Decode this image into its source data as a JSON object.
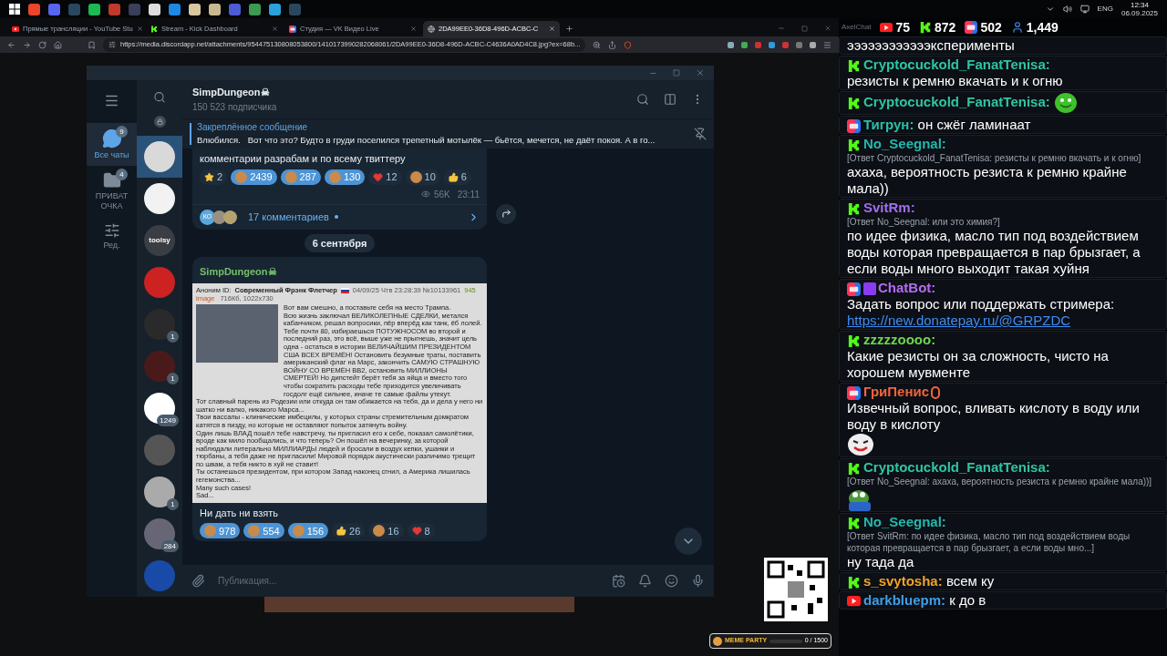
{
  "taskbar": {
    "language": "ENG",
    "time": "12:34",
    "date": "06.09.2025"
  },
  "browser": {
    "tabs": [
      {
        "title": "Прямые трансляции - YouTube Stu",
        "kind": "youtube",
        "selected": false
      },
      {
        "title": "Stream - Kick Dashboard",
        "kind": "kick",
        "selected": false
      },
      {
        "title": "Студия — VK Видео Live",
        "kind": "vk",
        "selected": false
      },
      {
        "title": "2DA99EE0-36D8-496D-ACBC-C",
        "kind": "page",
        "selected": true
      }
    ],
    "url": "https://media.discordapp.net/attachments/954475130808053800/1410173990282068061/2DA99EE0-36D8-496D-ACBC-C4636A0AD4C8.jpg?ex=68b..."
  },
  "telegram": {
    "folders": [
      {
        "kind": "chats",
        "label": "Все чаты",
        "badge": "9",
        "selected": true
      },
      {
        "kind": "folder",
        "label": "ПРИВАТОЧКА",
        "badge": "4",
        "selected": false
      },
      {
        "kind": "edit",
        "label": "Ред.",
        "selected": false
      }
    ],
    "chats": [
      {
        "selected": true
      },
      {
        "selected": false
      },
      {
        "selected": false,
        "label": "toolsy"
      },
      {
        "selected": false
      },
      {
        "selected": false,
        "badge": "1"
      },
      {
        "selected": false,
        "badge": "1"
      },
      {
        "selected": false,
        "badge": "1249"
      },
      {
        "selected": false
      },
      {
        "selected": false,
        "badge": "1"
      },
      {
        "selected": false,
        "badge": "284"
      },
      {
        "selected": false
      }
    ],
    "channel": {
      "title": "SimpDungeon☠",
      "subtitle": "150 523 подписчика"
    },
    "pinned": {
      "label": "Закреплённое сообщение",
      "text": "Влюбился.   Вот что это? Будто в груди поселился трепетный мотылёк — бьётся, мечется, не даёт покоя. А в го..."
    },
    "messages": [
      {
        "kind": "post",
        "text": "комментарии разрабам и по всему твиттеру",
        "views": "56K",
        "time": "23:11",
        "comments": "17 комментариев",
        "commenter": "КО",
        "reactions": [
          {
            "kind": "star",
            "count": "2",
            "selected": false
          },
          {
            "kind": "sticker",
            "count": "2439",
            "selected": true
          },
          {
            "kind": "sticker",
            "count": "287",
            "selected": true
          },
          {
            "kind": "sticker",
            "count": "130",
            "selected": true
          },
          {
            "kind": "heart",
            "count": "12",
            "selected": false
          },
          {
            "kind": "sticker",
            "count": "10",
            "selected": false
          },
          {
            "kind": "thumb",
            "count": "6",
            "selected": false
          }
        ]
      },
      {
        "kind": "date",
        "text": "6 сентября"
      },
      {
        "kind": "post",
        "author": "SimpDungeon☠",
        "caption": "Ни дать ни взять",
        "image": {
          "anon": "Аноним ID:",
          "name": "Современный Фрэнк Флетчер",
          "stamp": "04/09/25 Чтв 23:28:39 №10133961",
          "count": "945",
          "file": "image",
          "file_info": "716Кб, 1022x730",
          "lines": [
            "Вот вам смешно, а поставьте себя на место Трампа.",
            "Всю жизнь заключал ВЕЛИКОЛЕПНЫЕ СДЕЛКИ, метался кабанчиком, решал вопросики, пёр вперёд как танк, ёб лолей. Тебе почти 80, избираешься ПОТУЖНОСОМ во второй и последний раз, это всё, выше уже не прыгнешь, значит цель одна - остаться в истории ВЕЛИЧАЙШИМ ПРЕЗИДЕНТОМ США ВСЕХ ВРЕМЁН! Остановить безумные траты, поставить американский флаг на Марс, закончить САМУЮ СТРАШНУЮ ВОЙНУ СО ВРЕМЁН ВВ2, остановить МИЛЛИОНЫ СМЕРТЕЙ! Но дипстейт берёт тебя за яйца и вместо того чтобы сократить расходы тебе приходится увеличивать госдолг ещё сильнее, иначе те самые файлы утекут.",
            "Тот славный парень из Родезии или откуда он там обижается на тебя, да и дела у него ни шатко ни валко, никакого Марса...",
            "Твои вассалы - клинические имбецилы, у которых страны стремительным домкратом катятся в пизду, но которые не оставляют попыток затянуть войну.",
            "Один лишь ВЛАД пошёл тебе навстречу, ты пригласил его к себе, показал самолётики, вроде как мило пообщались, и что теперь? Он пошёл на вечеринку, за которой наблюдали литерально МИЛЛИАРДЫ людей и бросали в воздух кепки, ушанки и тюрбаны, а тебя даже не пригласили! Мировой порядок акустически различимо трещит по швам, а тебя никто в хуй не ставит!",
            "Ты останешься президентом, при котором Запад наконец сгнил, а Америка лишилась гегемонства...",
            "Many such cases!",
            "Sad..."
          ]
        },
        "reactions": [
          {
            "kind": "sticker",
            "count": "978",
            "selected": true
          },
          {
            "kind": "sticker",
            "count": "554",
            "selected": true
          },
          {
            "kind": "sticker",
            "count": "156",
            "selected": true
          },
          {
            "kind": "thumb",
            "count": "26",
            "selected": false
          },
          {
            "kind": "sticker",
            "count": "16",
            "selected": false
          },
          {
            "kind": "heart",
            "count": "8",
            "selected": false
          }
        ]
      }
    ],
    "input": {
      "placeholder": "Публикация..."
    }
  },
  "chat": {
    "title": "AxelChat",
    "counts": [
      {
        "kind": "youtube",
        "value": "75"
      },
      {
        "kind": "kick",
        "value": "872"
      },
      {
        "kind": "vk",
        "value": "502"
      },
      {
        "kind": "viewers",
        "value": "1,449"
      }
    ],
    "messages": [
      {
        "text": "ээээээээээээксперименты"
      },
      {
        "kind": "kick",
        "author": "Cryptocuckold_FanatTenisa:",
        "color": "#2fc5a2",
        "text": "резисты к ремню вкачать и к огню"
      },
      {
        "kind": "kick",
        "author": "Cryptocuckold_FanatTenisa:",
        "color": "#2fc5a2",
        "emote": {
          "kind": "smile"
        }
      },
      {
        "kind": "vk",
        "author": "Тигрун:",
        "color": "#2bbfa8",
        "text": "он сжёг ламинаат"
      },
      {
        "kind": "kick",
        "author": "No_Seegnal:",
        "color": "#22b8ad",
        "reply": "[Ответ Cryptocuckold_FanatTenisa: резисты к ремню вкачать и к огню]",
        "text": "ахаха, вероятность резиста к ремню крайне мала))"
      },
      {
        "kind": "kick",
        "author": "SvitRm:",
        "color": "#a46cf2",
        "reply": "[Ответ No_Seegnal: или это химия?]",
        "text": "по идее физика, масло тип под воздействием воды которая превращается в пар брызгает, а если воды много выходит такая хуйня"
      },
      {
        "kind": "vk",
        "badge": {
          "kind": "bot"
        },
        "author": "ChatBot:",
        "color": "#b46cf5",
        "text": "Задать вопрос или поддержать стримера:",
        "link": "https://new.donatepay.ru/@GRPZDC"
      },
      {
        "kind": "kick",
        "author": "zzzzzoooo:",
        "color": "#6fd64c",
        "text": "Какие резисты он за сложность, чисто на хорошем мувменте"
      },
      {
        "kind": "vk",
        "badge": {
          "kind": "symbol"
        },
        "author": "ГриПенис",
        "color": "#f0643c",
        "text": "Извечный вопрос, вливать кислоту в воду или воду в кислоту",
        "emote": {
          "kind": "joker"
        }
      },
      {
        "kind": "kick",
        "author": "Cryptocuckold_FanatTenisa:",
        "color": "#2fc5a2",
        "reply": "[Ответ No_Seegnal: ахаха, вероятность резиста к ремню крайне мала))]",
        "emote": {
          "kind": "frog"
        }
      },
      {
        "kind": "kick",
        "author": "No_Seegnal:",
        "color": "#22b8ad",
        "reply": "[Ответ SvitRm: по идее физика, масло тип под воздействием воды которая превращается в пар брызгает, а если воды мно...]",
        "text": "ну тада да"
      },
      {
        "kind": "kick",
        "author": "s_svytosha:",
        "color": "#f0a428",
        "text": "всем ку"
      },
      {
        "kind": "youtube",
        "author": "darkbluepm:",
        "color": "#3e9fe8",
        "text": "к до в"
      }
    ]
  },
  "overlay": {
    "title": "MEME PARTY",
    "progress": "0 / 1500",
    "level": 0
  }
}
